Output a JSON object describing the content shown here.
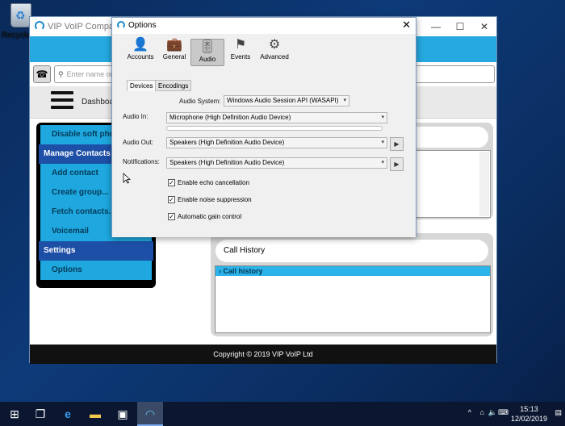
{
  "desktop": {
    "recycle_label": "Recycle"
  },
  "app": {
    "title": "VIP VoIP Companion",
    "search_placeholder": "Enter name or num",
    "nav_label": "Dashboar",
    "menu": [
      {
        "label": "Disable soft pho",
        "style": "blue"
      },
      {
        "label": "Manage Contacts",
        "style": "hdr"
      },
      {
        "label": "Add contact",
        "style": "blue"
      },
      {
        "label": "Create group...",
        "style": "blue"
      },
      {
        "label": "Fetch contacts...",
        "style": "blue"
      },
      {
        "label": "Voicemail",
        "style": "blue"
      },
      {
        "label": "Settings",
        "style": "hdr"
      },
      {
        "label": "Options",
        "style": "blue"
      }
    ],
    "call_history_title": "Call History",
    "call_history_node": "Call history",
    "footer": "Copyright © 2019 VIP VoIP Ltd"
  },
  "dialog": {
    "title": "Options",
    "toolbar": [
      "Accounts",
      "General",
      "Audio",
      "Events",
      "Advanced"
    ],
    "active_tool": "Audio",
    "tabs": [
      "Devices",
      "Encodings"
    ],
    "audio_system_label": "Audio System:",
    "audio_system_value": "Windows Audio Session API (WASAPI)",
    "audio_in_label": "Audio In:",
    "audio_in_value": "Microphone (High Definition Audio Device)",
    "audio_out_label": "Audio Out:",
    "audio_out_value": "Speakers (High Definition Audio Device)",
    "notifications_label": "Notifications:",
    "notifications_value": "Speakers (High Definition Audio Device)",
    "checkboxes": [
      {
        "label": "Enable echo cancellation",
        "checked": true
      },
      {
        "label": "Enable noise suppression",
        "checked": true
      },
      {
        "label": "Automatic gain control",
        "checked": true
      }
    ]
  },
  "taskbar": {
    "time": "15:13",
    "date": "12/02/2019"
  },
  "colors": {
    "accent": "#1ea8df",
    "menu_header": "#1d4fa6"
  }
}
